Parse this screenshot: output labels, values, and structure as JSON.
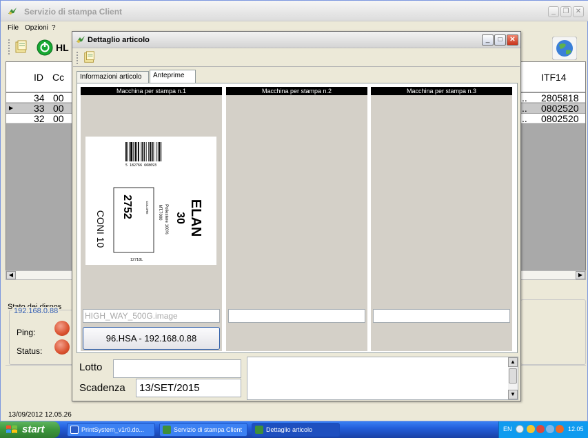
{
  "main_window": {
    "title": "Servizio di stampa Client",
    "menu": [
      "File",
      "Opzioni",
      "?"
    ],
    "toolbar_partial_label": "HL",
    "columns": [
      "ID",
      "Cc",
      "ITF14"
    ],
    "rows": [
      {
        "id": "34",
        "code": "00",
        "itf14": "2805818"
      },
      {
        "id": "33",
        "code": "00",
        "itf14": "0802520",
        "selected": true
      },
      {
        "id": "32",
        "code": "00",
        "itf14": "0802520"
      }
    ],
    "ellipsis": "..",
    "status_section_title": "Stato dei dispos",
    "device_ip": "192.168.0.88",
    "ping_label": "Ping:",
    "status_label": "Status:",
    "status_bar_time": "13/09/2012 12.05.26"
  },
  "dialog": {
    "title": "Dettaglio articolo",
    "tabs": [
      {
        "label": "Informazioni articolo",
        "active": false
      },
      {
        "label": "Anteprime",
        "active": true
      }
    ],
    "machines": [
      {
        "header": "Macchina per stampa n.1",
        "image_name": "HIGH_WAY_500G.image",
        "button": "96.HSA - 192.168.0.88"
      },
      {
        "header": "Macchina per stampa n.2",
        "image_name": "",
        "button": ""
      },
      {
        "header": "Macchina per stampa n.3",
        "image_name": "",
        "button": ""
      }
    ],
    "label_preview": {
      "barcode_text": "5 182766 668693",
      "brand": "ELAN",
      "brand_number": "30",
      "composition": "Poliestere 100%",
      "length": "MT.7000",
      "color_title": "COLORE",
      "color_code": "2752",
      "coni": "CONI 10",
      "lot": "12718L"
    },
    "lotto_label": "Lotto",
    "lotto_value": "",
    "scadenza_label": "Scadenza",
    "scadenza_value": "13/SET/2015"
  },
  "taskbar": {
    "start": "start",
    "tasks": [
      {
        "label": "PrintSystem_v1r0.do...",
        "active": false
      },
      {
        "label": "Servizio di stampa Client",
        "active": false
      },
      {
        "label": "Dettaglio articolo",
        "active": true
      }
    ],
    "language": "EN",
    "clock": "12.05"
  },
  "colors": {
    "accent_blue": "#245edb",
    "led_red": "#d9512f",
    "start_green": "#3c963c",
    "ip_text": "#2f5bb3"
  }
}
